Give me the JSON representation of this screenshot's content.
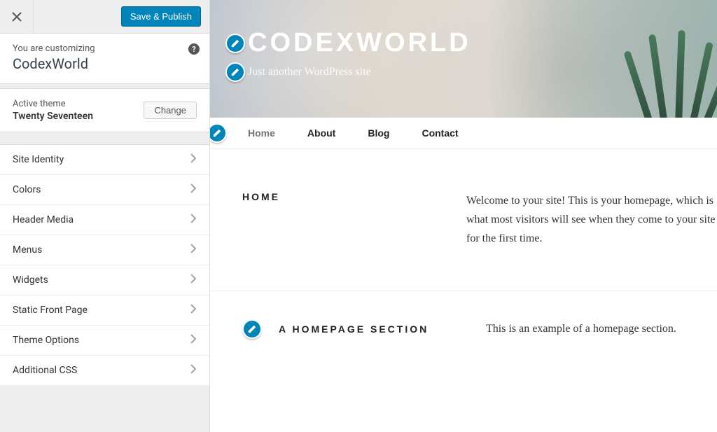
{
  "sidebar": {
    "save_label": "Save & Publish",
    "customizing_label": "You are customizing",
    "site_name": "CodexWorld",
    "active_theme_label": "Active theme",
    "active_theme_name": "Twenty Seventeen",
    "change_label": "Change",
    "items": [
      {
        "label": "Site Identity"
      },
      {
        "label": "Colors"
      },
      {
        "label": "Header Media"
      },
      {
        "label": "Menus"
      },
      {
        "label": "Widgets"
      },
      {
        "label": "Static Front Page"
      },
      {
        "label": "Theme Options"
      },
      {
        "label": "Additional CSS"
      }
    ]
  },
  "preview": {
    "site_title": "CODEXWORLD",
    "tagline": "Just another WordPress site",
    "nav": [
      {
        "label": "Home",
        "current": true
      },
      {
        "label": "About",
        "current": false
      },
      {
        "label": "Blog",
        "current": false
      },
      {
        "label": "Contact",
        "current": false
      }
    ],
    "sections": [
      {
        "heading": "HOME",
        "body": "Welcome to your site! This is your homepage, which is what most visitors will see when they come to your site for the first time."
      },
      {
        "heading": "A HOMEPAGE SECTION",
        "body": "This is an example of a homepage section."
      }
    ]
  }
}
